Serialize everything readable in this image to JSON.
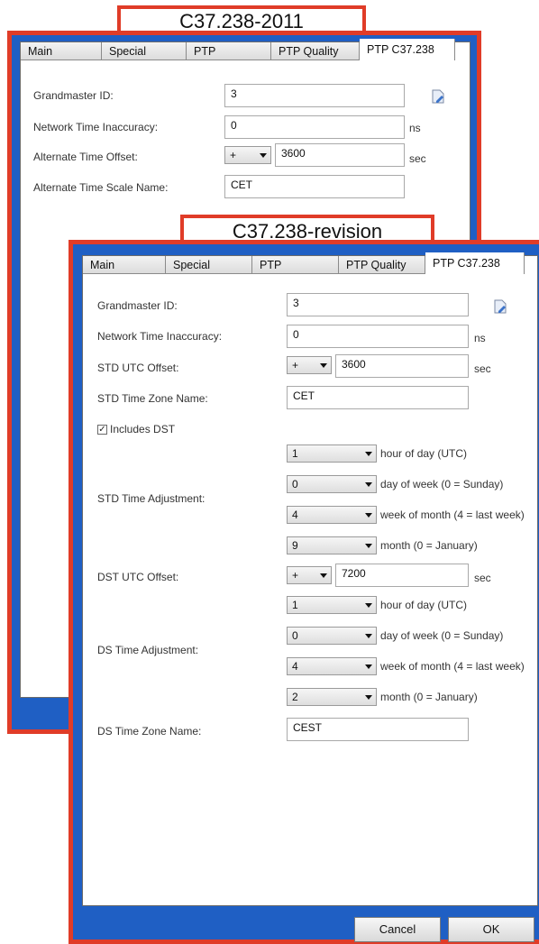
{
  "top_label": "C37.238-2011",
  "bottom_label": "C37.238-revision",
  "win1": {
    "tabs": [
      "Main",
      "Special",
      "PTP",
      "PTP Quality",
      "PTP C37.238"
    ],
    "rows": [
      {
        "label": "Grandmaster ID:",
        "value": "3"
      },
      {
        "label": "Network Time Inaccuracy:",
        "value": "0",
        "unit": "ns"
      },
      {
        "label": "Alternate Time Offset:",
        "sign": "+",
        "value": "3600",
        "unit": "sec"
      },
      {
        "label": "Alternate Time Scale Name:",
        "value": "CET"
      }
    ]
  },
  "win2": {
    "tabs": [
      "Main",
      "Special",
      "PTP",
      "PTP Quality",
      "PTP C37.238"
    ],
    "grandmaster_label": "Grandmaster ID:",
    "grandmaster_value": "3",
    "inaccuracy_label": "Network Time Inaccuracy:",
    "inaccuracy_value": "0",
    "inaccuracy_unit": "ns",
    "std_offset_label": "STD UTC Offset:",
    "std_offset_sign": "+",
    "std_offset_value": "3600",
    "std_offset_unit": "sec",
    "std_zone_label": "STD Time Zone Name:",
    "std_zone_value": "CET",
    "includes_dst_label": "Includes DST",
    "includes_dst_checked": true,
    "std_adjust_label": "STD Time Adjustment:",
    "std_adjust": [
      {
        "value": "1",
        "desc": "hour of day (UTC)"
      },
      {
        "value": "0",
        "desc": "day of week (0 = Sunday)"
      },
      {
        "value": "4",
        "desc": "week of month (4 = last week)"
      },
      {
        "value": "9",
        "desc": "month (0 = January)"
      }
    ],
    "dst_offset_label": "DST UTC Offset:",
    "dst_offset_sign": "+",
    "dst_offset_value": "7200",
    "dst_offset_unit": "sec",
    "ds_adjust_label": "DS Time Adjustment:",
    "ds_adjust": [
      {
        "value": "1",
        "desc": "hour of day (UTC)"
      },
      {
        "value": "0",
        "desc": "day of week (0 = Sunday)"
      },
      {
        "value": "4",
        "desc": "week of month (4 = last week)"
      },
      {
        "value": "2",
        "desc": "month (0 = January)"
      }
    ],
    "ds_zone_label": "DS Time Zone Name:",
    "ds_zone_value": "CEST",
    "cancel_label": "Cancel",
    "ok_label": "OK"
  },
  "colors": {
    "accent_red": "#e03c28",
    "window_blue": "#1f5fc4"
  }
}
